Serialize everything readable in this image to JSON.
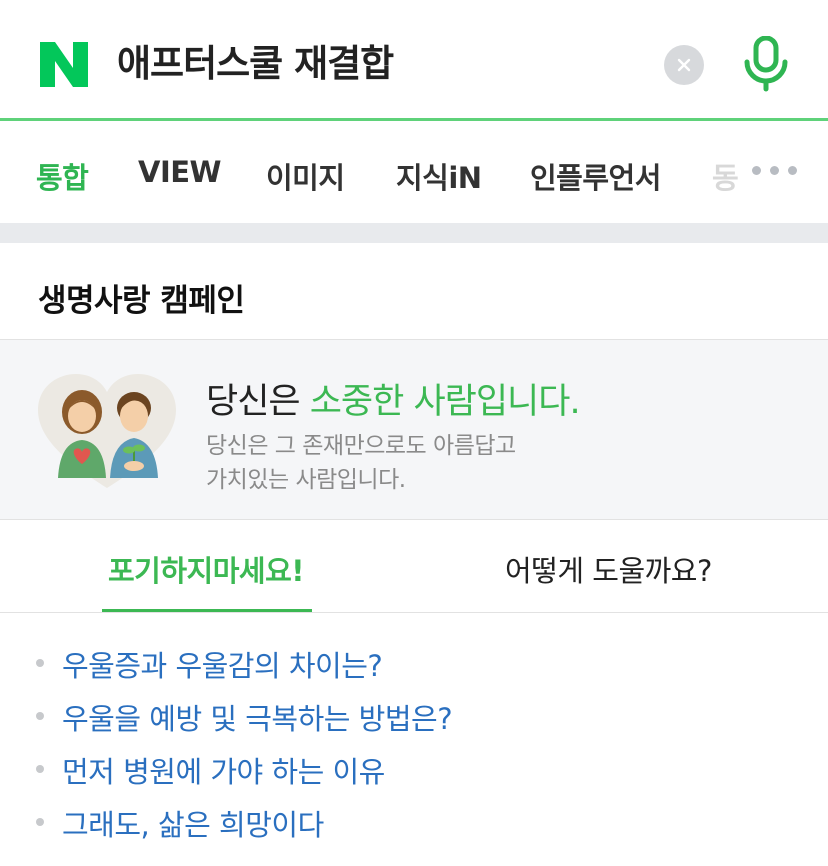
{
  "search": {
    "logo_letter": "N",
    "query": "애프터스쿨 재결합",
    "brand_color": "#03c75a"
  },
  "tabs": [
    {
      "label": "통합",
      "active": true
    },
    {
      "label": "VIEW",
      "active": false
    },
    {
      "label": "이미지",
      "active": false
    },
    {
      "label": "지식iN",
      "active": false
    },
    {
      "label": "인플루언서",
      "active": false
    },
    {
      "label": "동",
      "active": false
    }
  ],
  "campaign": {
    "title": "생명사랑 캠페인",
    "headline_plain": "당신은 ",
    "headline_accent": "소중한 사람입니다.",
    "sub_line1": "당신은 그 존재만으로도 아름답고",
    "sub_line2": "가치있는 사람입니다."
  },
  "subtabs": {
    "active_label": "포기하지마세요!",
    "other_label": "어떻게 도울까요?"
  },
  "links": [
    "우울증과 우울감의 차이는?",
    "우울을 예방 및 극복하는 방법은?",
    "먼저 병원에 가야 하는 이유",
    "그래도, 삶은 희망이다"
  ],
  "colors": {
    "accent_green": "#3cb853",
    "link_blue": "#2a6fbf"
  }
}
